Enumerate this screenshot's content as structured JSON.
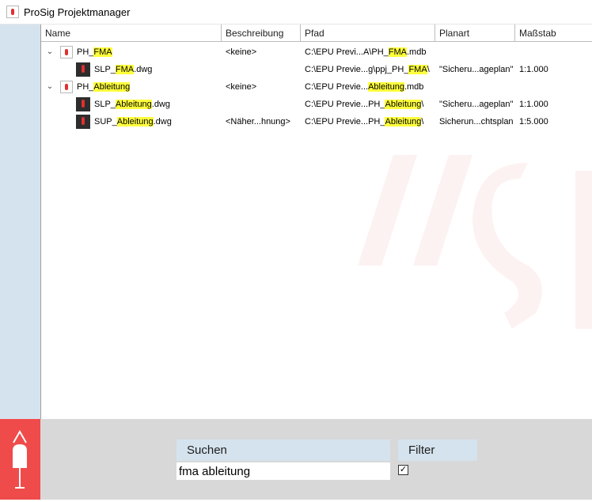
{
  "window": {
    "title": "ProSig Projektmanager"
  },
  "grid": {
    "columns": [
      "Name",
      "Beschreibung",
      "Pfad",
      "Planart",
      "Maßstab"
    ],
    "rows": [
      {
        "name_pre": "PH_",
        "name_hl": "FMA",
        "name_post": "",
        "description": "<keine>",
        "path_pre": "C:\\EPU Previ...A\\PH_",
        "path_hl": "FMA",
        "path_post": ".mdb",
        "plan": "",
        "scale": ""
      },
      {
        "name_pre": "SLP_",
        "name_hl": "FMA",
        "name_post": ".dwg",
        "description": "",
        "path_pre": "C:\\EPU Previe...g\\ppj_PH_",
        "path_hl": "FMA",
        "path_post": "\\",
        "plan": "\"Sicheru...ageplan\"",
        "scale": "1:1.000"
      },
      {
        "name_pre": "PH_",
        "name_hl": "Ableitung",
        "name_post": "",
        "description": "<keine>",
        "path_pre": "C:\\EPU Previe...",
        "path_hl": "Ableitung",
        "path_post": ".mdb",
        "plan": "",
        "scale": ""
      },
      {
        "name_pre": "SLP_",
        "name_hl": "Ableitung",
        "name_post": ".dwg",
        "description": "",
        "path_pre": "C:\\EPU Previe...PH_",
        "path_hl": "Ableitung",
        "path_post": "\\",
        "plan": "\"Sicheru...ageplan\"",
        "scale": "1:1.000"
      },
      {
        "name_pre": "SUP_",
        "name_hl": "Ableitung",
        "name_post": ".dwg",
        "description": "<Näher...hnung>",
        "path_pre": "C:\\EPU Previe...PH_",
        "path_hl": "Ableitung",
        "path_post": "\\",
        "plan": "Sicherun...chtsplan",
        "scale": "1:5.000"
      }
    ]
  },
  "search": {
    "label": "Suchen",
    "value": "fma ableitung"
  },
  "filter": {
    "label": "Filter",
    "checked": true,
    "check_glyph": "✓"
  },
  "icons": {
    "expander": "chevron-down-icon",
    "project": "database-icon",
    "drawing": "dwg-file-icon",
    "logo": "buoy-logo-icon"
  },
  "colors": {
    "highlight": "#ffff3c",
    "sidebar": "#d5e3ee",
    "logo": "#f04b4b",
    "bottom_panel": "#d8d8d8"
  }
}
